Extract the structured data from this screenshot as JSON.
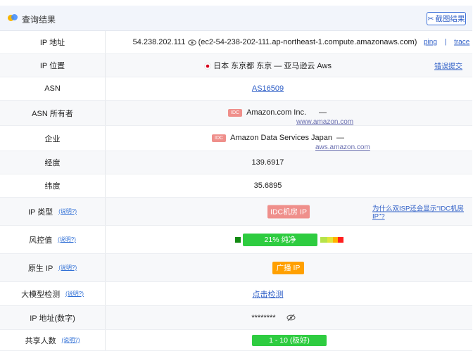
{
  "header": {
    "title": "查询结果",
    "screenshot_label": "截图结果",
    "screenshot_icon": "scissors-icon"
  },
  "ip_address": {
    "label": "IP 地址",
    "ip": "54.238.202.111",
    "hostname": "(ec2-54-238-202-111.ap-northeast-1.compute.amazonaws.com)",
    "ping": "ping",
    "separator": "|",
    "trace": "trace",
    "icon": "eye-icon"
  },
  "ip_location": {
    "label": "IP 位置",
    "flag_icon": "japan-flag-icon",
    "value": "日本 东京都 东京 — 亚马逊云 Aws",
    "report": "错误提交"
  },
  "asn": {
    "label": "ASN",
    "value": "AS16509"
  },
  "asn_owner": {
    "label": "ASN 所有者",
    "badge": "IDC",
    "name": "Amazon.com Inc.",
    "dash": "—",
    "domain": "www.amazon.com"
  },
  "company": {
    "label": "企业",
    "badge": "IDC",
    "name": "Amazon Data Services Japan",
    "dash": "—",
    "domain": "aws.amazon.com"
  },
  "longitude": {
    "label": "经度",
    "value": "139.6917"
  },
  "latitude": {
    "label": "纬度",
    "value": "35.6895"
  },
  "ip_type": {
    "label": "IP 类型",
    "tip": "(说明?)",
    "value": "IDC机房 IP",
    "question": "为什么双ISP还会显示\"IDC机房IP\"?"
  },
  "risk": {
    "label": "风控值",
    "tip": "(说明?)",
    "value": "21%  纯净",
    "percent": 21
  },
  "native_ip": {
    "label": "原生 IP",
    "tip": "(说明?)",
    "value": "广播 IP"
  },
  "llm_check": {
    "label": "大模型检测",
    "tip": "(说明?)",
    "value": "点击检测"
  },
  "ip_numeric": {
    "label": "IP 地址(数字)",
    "value": "********",
    "icon": "eye-off-icon"
  },
  "shared": {
    "label": "共享人数",
    "tip": "(说明?)",
    "value": "1 - 10 (极好)"
  },
  "colors": {
    "accent": "#2f5fc7",
    "green": "#2ecc40",
    "dark_green": "#138a13",
    "orange": "#ffa000",
    "idc_red": "#ef8f8b",
    "header_bg": "#f2f5fb"
  }
}
